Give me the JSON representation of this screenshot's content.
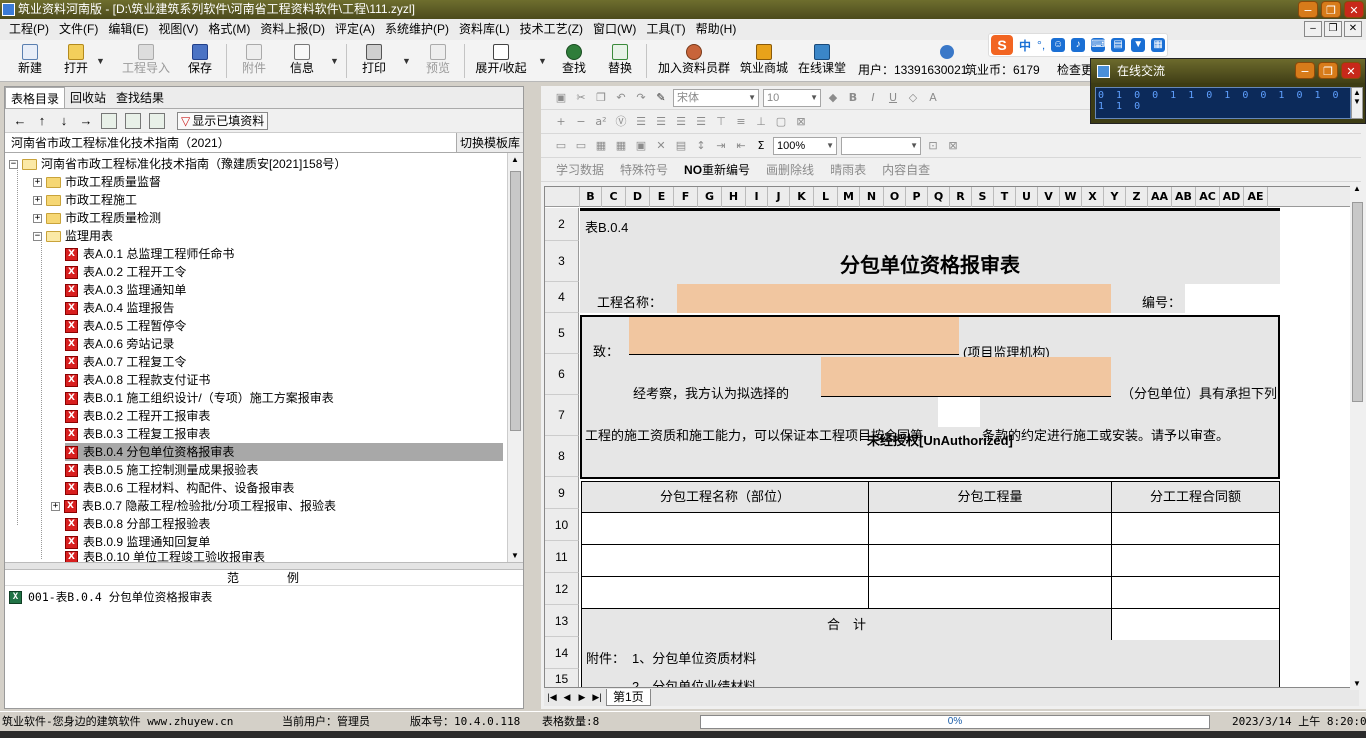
{
  "window": {
    "title": "筑业资料河南版 - [D:\\筑业建筑系列软件\\河南省工程资料软件\\工程\\111.zyzl]",
    "minimize": "−",
    "restore": "❐",
    "close": "✕"
  },
  "menu": [
    "工程(P)",
    "文件(F)",
    "编辑(E)",
    "视图(V)",
    "格式(M)",
    "资料上报(D)",
    "评定(A)",
    "系统维护(P)",
    "资料库(L)",
    "技术工艺(Z)",
    "窗口(W)",
    "工具(T)",
    "帮助(H)"
  ],
  "toolbar": {
    "new": "新建",
    "open": "打开",
    "import": "工程导入",
    "save": "保存",
    "attach": "附件",
    "info": "信息",
    "print": "打印",
    "preview": "预览",
    "expand": "展开/收起",
    "find": "查找",
    "replace": "替换",
    "join_group": "加入资料员群",
    "mall": "筑业商城",
    "online_class": "在线课堂",
    "user_label": "用户：13391630021",
    "coins_label": "筑业币：6179",
    "check_update": "检查更"
  },
  "ime": {
    "logo": "S",
    "lang": "中",
    "punct": "°,"
  },
  "chat": {
    "title": "在线交流",
    "body": "0 1 0  0 1 1 0 1  0 0 1  0 1 0 1 1 0"
  },
  "left": {
    "tabs": [
      "表格目录",
      "回收站",
      "查找结果"
    ],
    "show_filled": "显示已填资料",
    "template_name": "河南省市政工程标准化技术指南（2021）",
    "switch_template": "切换模板库",
    "tree": [
      "河南省市政工程标准化技术指南（豫建质安[2021]158号）",
      "市政工程质量监督",
      "市政工程施工",
      "市政工程质量检测",
      "监理用表",
      "表A.0.1 总监理工程师任命书",
      "表A.0.2 工程开工令",
      "表A.0.3 监理通知单",
      "表A.0.4 监理报告",
      "表A.0.5 工程暂停令",
      "表A.0.6 旁站记录",
      "表A.0.7 工程复工令",
      "表A.0.8 工程款支付证书",
      "表B.0.1 施工组织设计/（专项）施工方案报审表",
      "表B.0.2 工程开工报审表",
      "表B.0.3 工程复工报审表",
      "表B.0.4 分包单位资格报审表",
      "表B.0.5 施工控制测量成果报验表",
      "表B.0.6 工程材料、构配件、设备报审表",
      "表B.0.7 隐蔽工程/检验批/分项工程报审、报验表",
      "表B.0.8 分部工程报验表",
      "表B.0.9 监理通知回复单",
      "表B.0.10 单位工程竣工验收报审表"
    ],
    "example_fan": "范",
    "example_li": "例",
    "example_item": "001-表B.0.4 分包单位资格报审表"
  },
  "right": {
    "font": "宋体",
    "size": "10",
    "zoom": "100%",
    "row3_buttons": [
      "学习数据",
      "特殊符号",
      "重新编号",
      "画删除线",
      "晴雨表",
      "内容自查"
    ],
    "renumber_prefix": "NO",
    "columns": [
      "B",
      "C",
      "D",
      "E",
      "F",
      "G",
      "H",
      "I",
      "J",
      "K",
      "L",
      "M",
      "N",
      "O",
      "P",
      "Q",
      "R",
      "S",
      "T",
      "U",
      "V",
      "W",
      "X",
      "Y",
      "Z",
      "AA",
      "AB",
      "AC",
      "AD",
      "AE"
    ],
    "rows": [
      "2",
      "3",
      "4",
      "5",
      "6",
      "7",
      "8",
      "9",
      "10",
      "11",
      "12",
      "13",
      "14",
      "15"
    ],
    "sheet": {
      "table_no": "表B.0.4",
      "title": "分包单位资格报审表",
      "project_name_label": "工程名称：",
      "number_label": "编号：",
      "to_label": "致：",
      "supervisor_org": "(项目监理机构)",
      "after_review": "经考察，我方认为拟选择的",
      "sub_unit_suffix": "（分包单位）具有承担下列",
      "row7_text": "工程的施工资质和施工能力，可以保证本工程项目按合同第",
      "row7_tail": "条款的约定进行施工或安装。请予以审查。",
      "watermark": "未经授权[UnAuthorized]",
      "col_name": "分包工程名称（部位）",
      "col_qty": "分包工程量",
      "col_amount": "分工工程合同额",
      "total": "合　计",
      "attach_label": "附件：",
      "attach1": "1、分包单位资质材料",
      "attach2": "2、分包单位业绩材料"
    },
    "sheet_tab": "第1页"
  },
  "status": {
    "slogan": "筑业软件-您身边的建筑软件 www.zhuyew.cn",
    "current_user": "当前用户：管理员",
    "version": "版本号：10.4.0.118",
    "sheet_count": "表格数量:8",
    "progress": "0%",
    "progress_value": 0,
    "datetime": "2023/3/14 上午 8:20:01"
  }
}
